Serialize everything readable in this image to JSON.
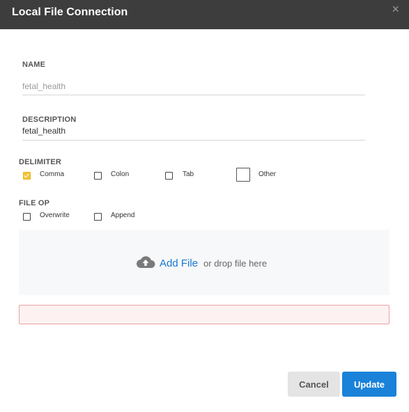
{
  "header": {
    "title": "Local File Connection",
    "close_glyph": "×"
  },
  "form": {
    "name": {
      "label": "NAME",
      "value": "fetal_health"
    },
    "description": {
      "label": "DESCRIPTION",
      "value": "fetal_health"
    },
    "delimiter": {
      "label": "DELIMITER",
      "options": [
        {
          "label": "Comma",
          "checked": true
        },
        {
          "label": "Colon",
          "checked": false
        },
        {
          "label": "Tab",
          "checked": false
        },
        {
          "label": "Other",
          "checked": false
        }
      ]
    },
    "file_op": {
      "label": "FILE OP",
      "options": [
        {
          "label": "Overwrite",
          "checked": false
        },
        {
          "label": "Append",
          "checked": false
        }
      ]
    },
    "upload": {
      "add_label": "Add File",
      "hint": "or drop file here"
    }
  },
  "footer": {
    "cancel_label": "Cancel",
    "update_label": "Update"
  },
  "colors": {
    "accent": "#1a82d8",
    "checked": "#f2c53d",
    "header_bg": "#3d3d3d",
    "error_border": "#e9a1a1"
  }
}
